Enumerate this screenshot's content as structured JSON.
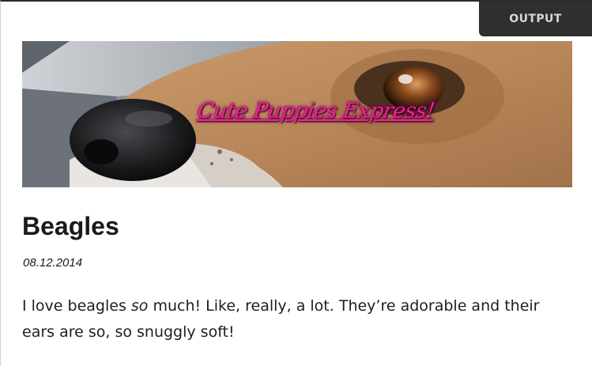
{
  "output_tab": {
    "label": "OUTPUT"
  },
  "banner": {
    "title": "Cute Puppies Express!",
    "image": "beagle-face-closeup"
  },
  "post": {
    "title": "Beagles",
    "date": "08.12.2014",
    "body_before": "I love beagles ",
    "body_emphasis": "so",
    "body_after": " much! Like, really, a lot. They’re adorable and their ears are so, so snuggly soft!"
  },
  "colors": {
    "tab_background": "#2f2f2f",
    "tab_text": "#d8d8d8",
    "banner_title": "#ff1aa0",
    "text": "#1a1a1a"
  }
}
